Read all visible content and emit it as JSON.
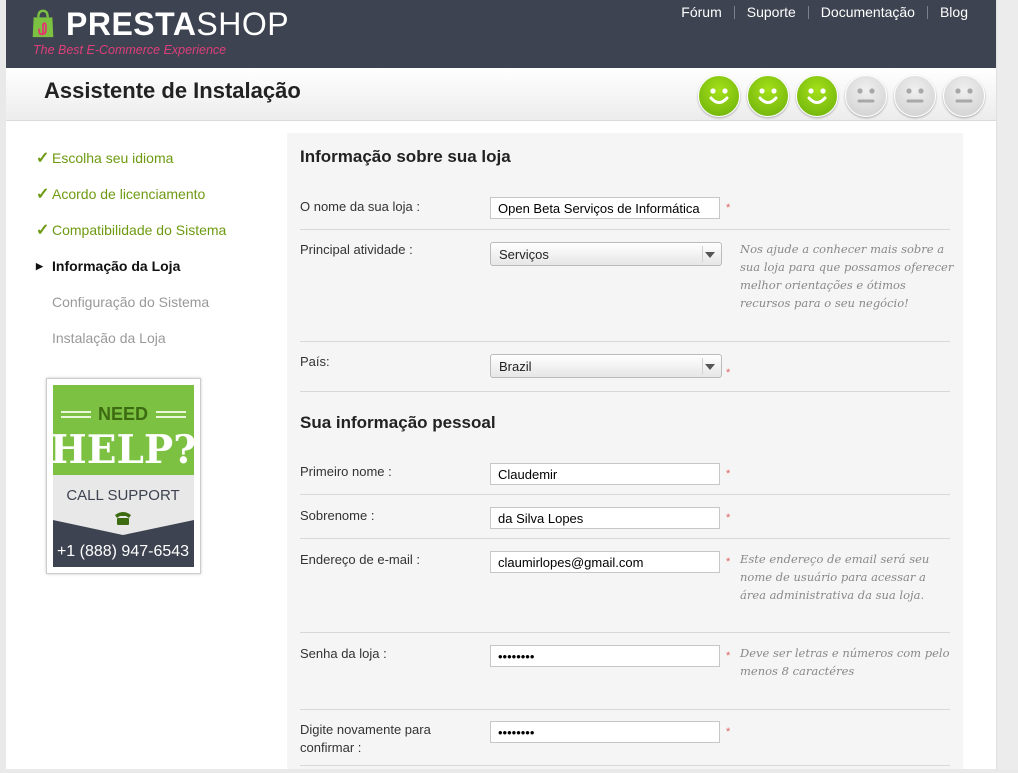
{
  "header": {
    "logo_presta": "PRESTA",
    "logo_shop": "SHOP",
    "tagline": "The Best E-Commerce Experience",
    "nav": [
      {
        "label": "Fórum"
      },
      {
        "label": "Suporte"
      },
      {
        "label": "Documentação"
      },
      {
        "label": "Blog"
      }
    ]
  },
  "title": "Assistente de Instalação",
  "progress": {
    "completed": 3,
    "total": 6
  },
  "steps": [
    {
      "label": "Escolha seu idioma",
      "state": "done"
    },
    {
      "label": "Acordo de licenciamento",
      "state": "done"
    },
    {
      "label": "Compatibilidade do Sistema",
      "state": "done"
    },
    {
      "label": "Informação da Loja",
      "state": "current"
    },
    {
      "label": "Configuração do Sistema",
      "state": "todo"
    },
    {
      "label": "Instalação da Loja",
      "state": "todo"
    }
  ],
  "help_banner": {
    "need": "NEED",
    "help": "HELP?",
    "call": "CALL SUPPORT",
    "phone": "+1 (888) 947-6543"
  },
  "store_section": {
    "title": "Informação sobre sua loja",
    "store_name_label": "O nome da sua loja :",
    "store_name_value": "Open Beta Serviços de Informática",
    "activity_label": "Principal atividade :",
    "activity_value": "Serviços",
    "activity_hint": "Nos ajude a conhecer mais sobre a sua loja para que possamos oferecer melhor orientações e ótimos recursos para o seu negócio!",
    "country_label": "País:",
    "country_value": "Brazil"
  },
  "personal_section": {
    "title": "Sua informação pessoal",
    "first_name_label": "Primeiro nome :",
    "first_name_value": "Claudemir",
    "last_name_label": "Sobrenome :",
    "last_name_value": "da Silva Lopes",
    "email_label": "Endereço de e-mail :",
    "email_value": "claumirlopes@gmail.com",
    "email_hint": "Este endereço de email será seu nome de usuário para acessar a área administrativa da sua loja.",
    "password_label": "Senha da loja :",
    "password_value": "••••••••",
    "password_hint": "Deve ser letras e números com pelo menos 8 caractéres",
    "confirm_label": "Digite novamente para confirmar :",
    "confirm_value": "••••••••"
  },
  "required_marker": "*",
  "colors": {
    "header_bg": "#3d4350",
    "accent_green": "#6e9a12",
    "face_on": "#8ccc12",
    "face_off": "#d9d9d9",
    "tagline_pink": "#df3e7a",
    "required_red": "#e06060"
  }
}
